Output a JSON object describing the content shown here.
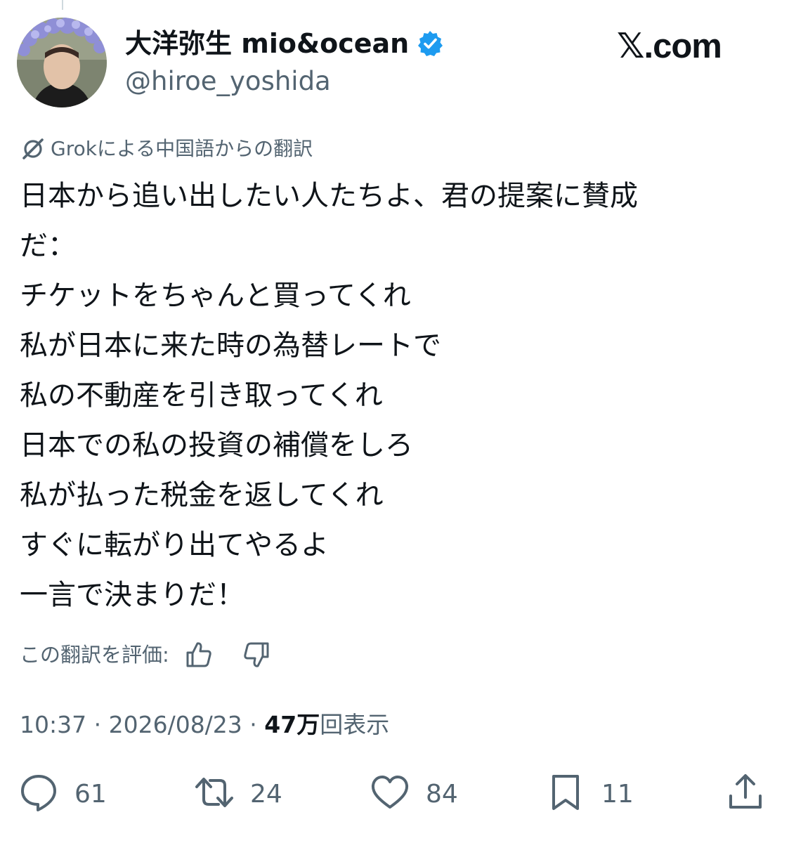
{
  "author": {
    "display_name": "大洋弥生 mio&ocean",
    "handle": "@hiroe_yoshida",
    "verified_icon": "verified-badge-icon",
    "avatar": "profile-photo"
  },
  "brand": {
    "label": "𝕏.com"
  },
  "translation": {
    "icon": "grok-icon",
    "note": "Grokによる中国語からの翻訳"
  },
  "tweet": {
    "lines": [
      "日本から追い出したい人たちよ、君の提案に賛成",
      "だ：",
      "チケットをちゃんと買ってくれ",
      "私が日本に来た時の為替レートで",
      "私の不動産を引き取ってくれ",
      "日本での私の投資の補償をしろ",
      "私が払った税金を返してくれ",
      "すぐに転がり出てやるよ",
      "一言で決まりだ！"
    ]
  },
  "rating": {
    "label": "この翻訳を評価:",
    "up_icon": "thumbs-up-icon",
    "down_icon": "thumbs-down-icon"
  },
  "meta": {
    "time": "10:37",
    "sep": " · ",
    "date": "2026/08/23",
    "views_count": "47万",
    "views_label": "回表示"
  },
  "actions": {
    "reply": {
      "icon": "reply-icon",
      "count": "61"
    },
    "repost": {
      "icon": "repost-icon",
      "count": "24"
    },
    "like": {
      "icon": "heart-icon",
      "count": "84"
    },
    "bookmark": {
      "icon": "bookmark-icon",
      "count": "11"
    },
    "share": {
      "icon": "share-icon"
    }
  },
  "colors": {
    "text": "#0f1419",
    "secondary": "#536471",
    "verified": "#1d9bf0",
    "background": "#ffffff"
  }
}
